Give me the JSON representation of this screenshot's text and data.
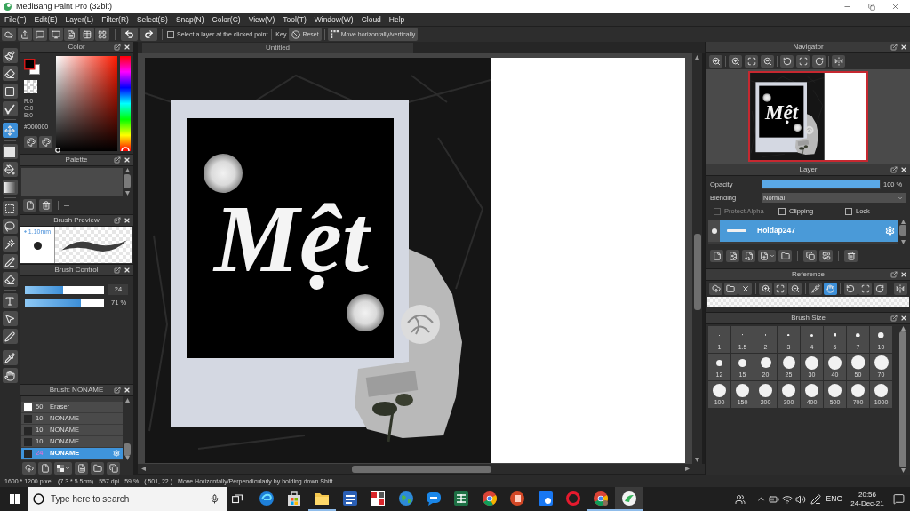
{
  "window": {
    "title": "MediBang Paint Pro (32bit)"
  },
  "menu": [
    "File(F)",
    "Edit(E)",
    "Layer(L)",
    "Filter(R)",
    "Select(S)",
    "Snap(N)",
    "Color(C)",
    "View(V)",
    "Tool(T)",
    "Window(W)",
    "Cloud",
    "Help"
  ],
  "toolbar": {
    "select_layer": {
      "label": "Select a layer at the clicked point",
      "checked": false
    },
    "key_label": "Key",
    "reset": "Reset",
    "move": "Move horizontally/vertically"
  },
  "tools": [
    {
      "selected": false
    },
    {
      "selected": false
    },
    {
      "selected": false
    },
    {
      "selected": false
    },
    {
      "selected": true
    },
    {
      "selected": false
    },
    {
      "selected": false
    },
    {
      "selected": false
    },
    {
      "selected": false
    },
    {
      "selected": false
    },
    {
      "selected": false
    },
    {
      "selected": false
    },
    {
      "selected": false
    },
    {
      "selected": false
    },
    {
      "selected": false
    },
    {
      "selected": false
    },
    {
      "selected": false
    },
    {
      "selected": false
    }
  ],
  "color_panel": {
    "title": "Color",
    "rgb": [
      "R:0",
      "G:0",
      "B:0"
    ],
    "hex": "#000000"
  },
  "palette": {
    "title": "Palette"
  },
  "brush_preview": {
    "title": "Brush Preview",
    "size": "1.10mm"
  },
  "brush_control": {
    "title": "Brush Control",
    "sliders": [
      {
        "level": 0.48,
        "reading": "24"
      },
      {
        "level": 0.71,
        "reading": "71 %"
      }
    ]
  },
  "brush_list": {
    "title": "Brush: NONAME",
    "items": [
      {
        "size": "50",
        "name": "Eraser",
        "color": "#ffffff",
        "selected": false
      },
      {
        "size": "10",
        "name": "NONAME",
        "color": "#262626",
        "selected": false
      },
      {
        "size": "10",
        "name": "NONAME",
        "color": "#262626",
        "selected": false
      },
      {
        "size": "10",
        "name": "NONAME",
        "color": "#262626",
        "selected": false
      },
      {
        "size": "24",
        "name": "NONAME",
        "color": "#262626",
        "selected": true
      }
    ]
  },
  "canvas": {
    "tab": "Untitled",
    "artwork_text": "Mệt"
  },
  "navigator": {
    "title": "Navigator",
    "preview_text": "Mệt"
  },
  "layer_panel": {
    "title": "Layer",
    "opacity_label": "Opacity",
    "opacity": {
      "level": 1,
      "reading": "100 %"
    },
    "blending_label": "Blending",
    "blending": "Normal",
    "options": [
      {
        "label": "Protect Alpha",
        "checked": false,
        "disabled": true
      },
      {
        "label": "Clipping",
        "checked": false,
        "disabled": false
      },
      {
        "label": "Lock",
        "checked": false,
        "disabled": false
      }
    ],
    "layers": [
      {
        "name": "Hoidap247",
        "selected": true,
        "visible": true
      }
    ]
  },
  "reference": {
    "title": "Reference",
    "tools": [
      {
        "selected": false
      },
      {
        "selected": false
      },
      {
        "selected": false
      },
      {
        "selected": false
      },
      {
        "selected": false
      },
      {
        "selected": false
      },
      {
        "selected": false
      },
      {
        "selected": true
      },
      {
        "selected": false
      },
      {
        "selected": false
      },
      {
        "selected": false
      },
      {
        "selected": false
      }
    ]
  },
  "brush_size": {
    "title": "Brush Size",
    "sizes": [
      "1",
      "1.5",
      "2",
      "3",
      "4",
      "5",
      "7",
      "10",
      "12",
      "15",
      "20",
      "25",
      "30",
      "40",
      "50",
      "70",
      "100",
      "150",
      "200",
      "300",
      "400",
      "500",
      "700",
      "1000"
    ]
  },
  "status_bar": {
    "size": "1600 * 1200 pixel",
    "print_size": "(7.3 * 5.5cm)",
    "dpi": "557 dpi",
    "zoom": "59 %",
    "cursor": "( 501, 22 )",
    "hint": "Move Horizontally/Perpendicularly by holding down Shift"
  },
  "taskbar": {
    "search_placeholder": "Type here to search",
    "apps": [
      {
        "running": false,
        "active": false
      },
      {
        "running": false,
        "active": false
      },
      {
        "running": true,
        "active": false
      },
      {
        "running": false,
        "active": false
      },
      {
        "running": false,
        "active": false
      },
      {
        "running": false,
        "active": false
      },
      {
        "running": false,
        "active": false
      },
      {
        "running": false,
        "active": false
      },
      {
        "running": false,
        "active": false
      },
      {
        "running": false,
        "active": false
      },
      {
        "running": false,
        "active": false
      },
      {
        "running": false,
        "active": false
      },
      {
        "running": true,
        "active": false
      },
      {
        "running": true,
        "active": true
      }
    ],
    "language": "ENG",
    "time": "20:56",
    "date": "24-Dec-21"
  }
}
